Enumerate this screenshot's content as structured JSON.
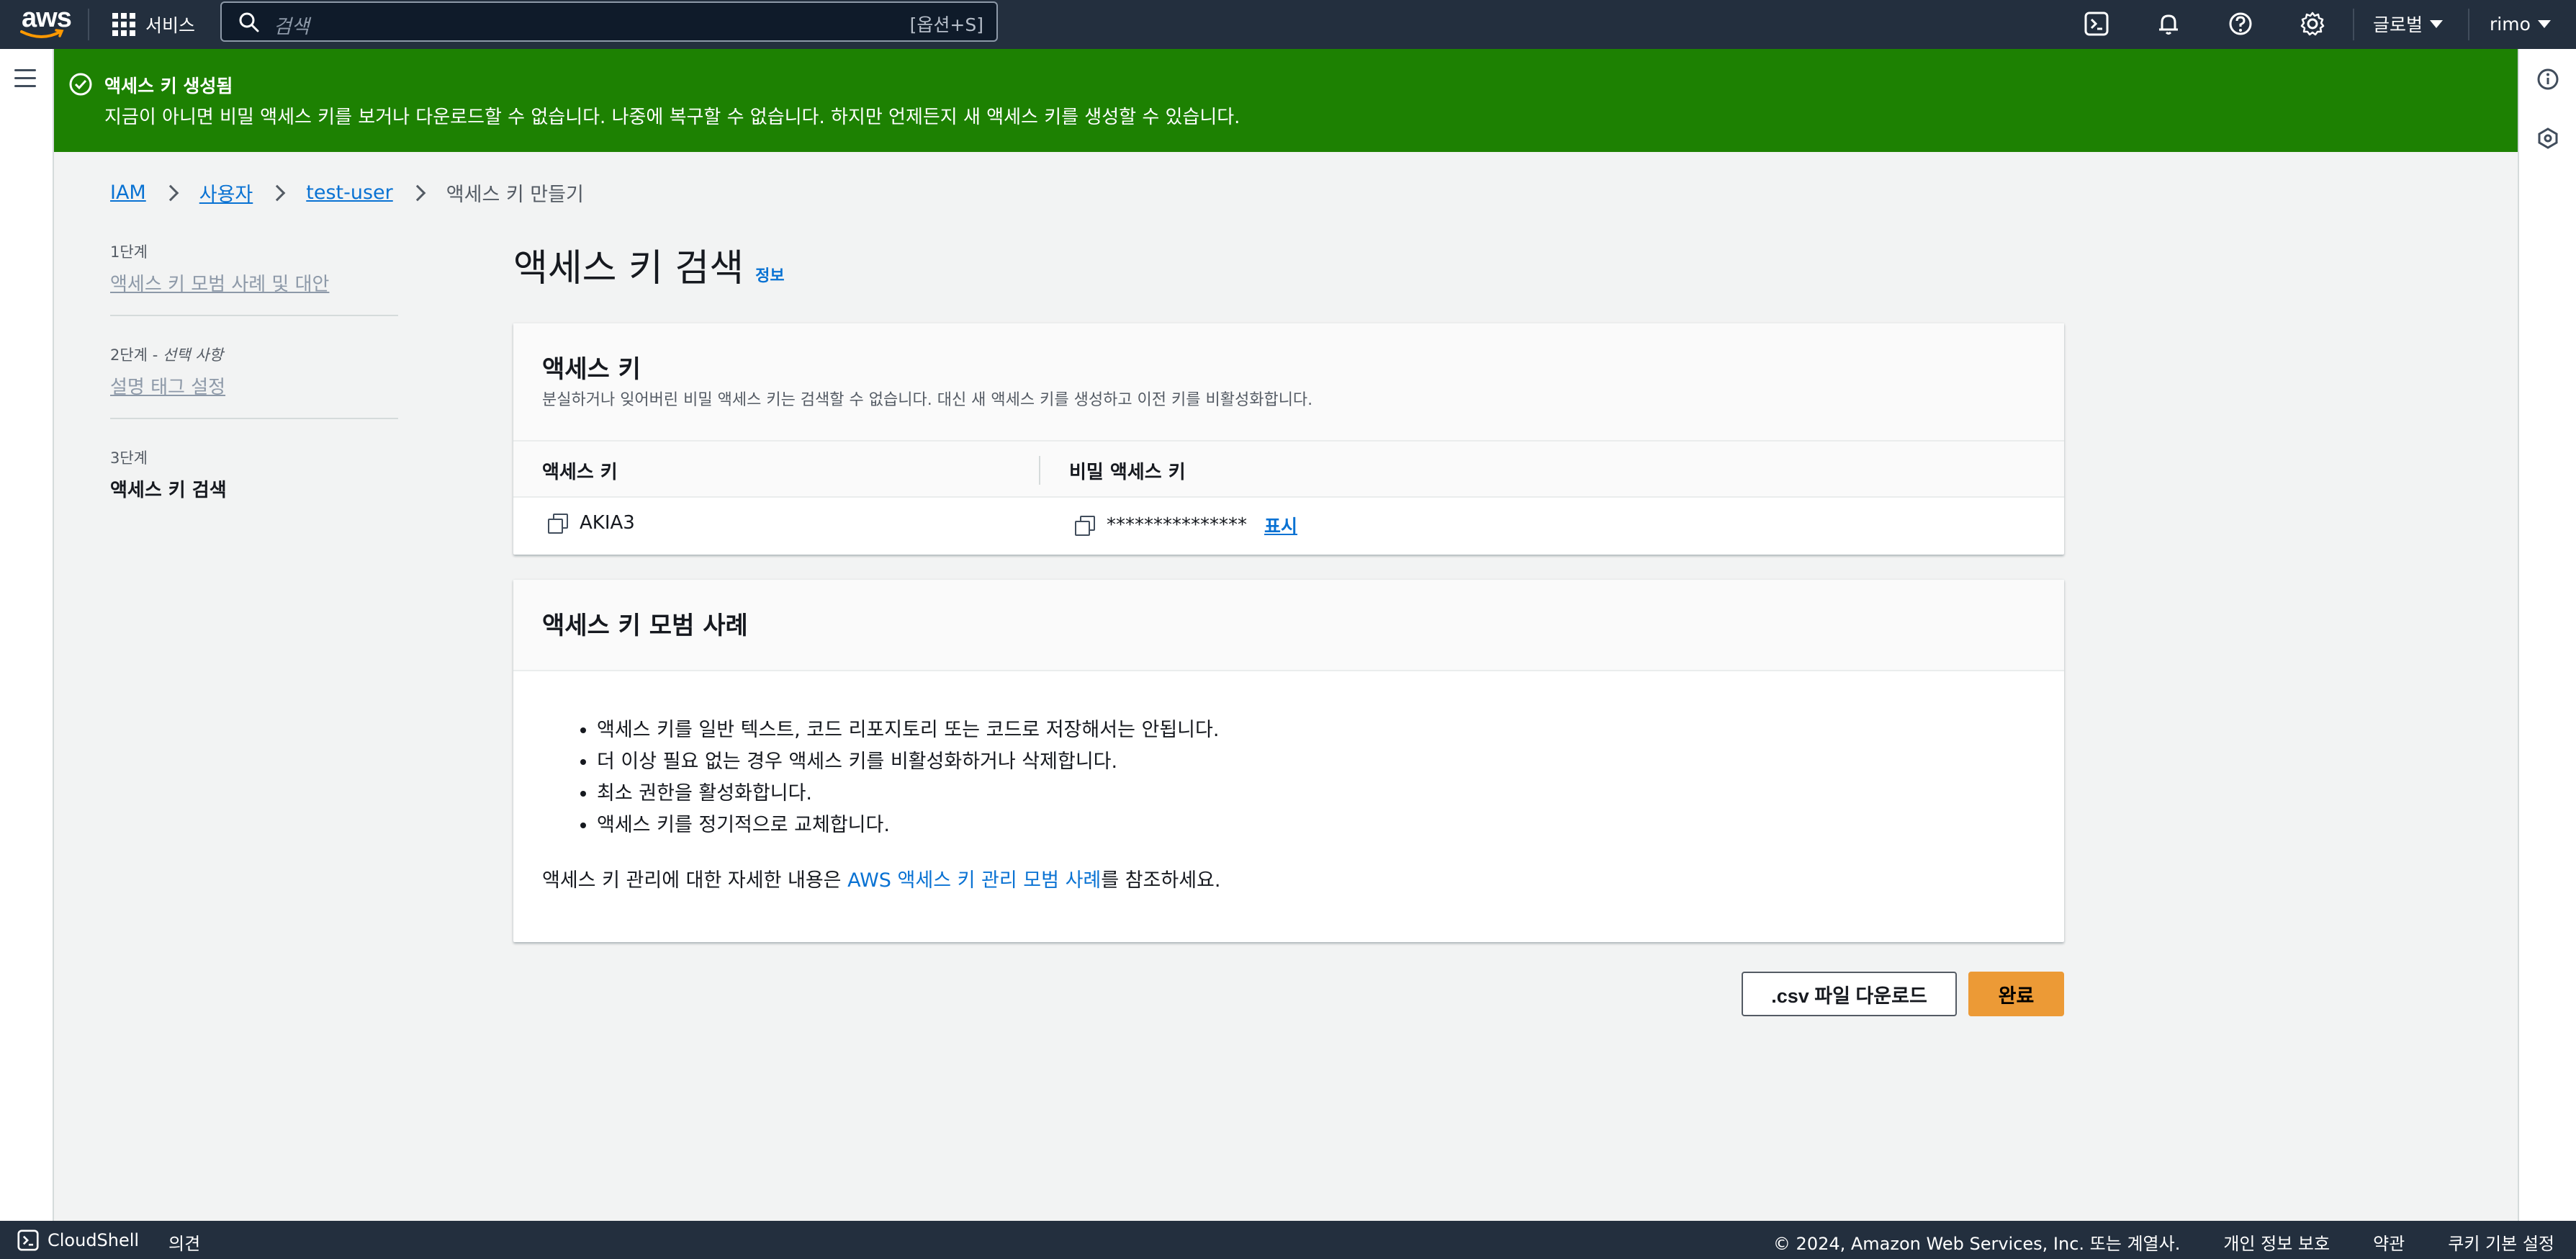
{
  "nav": {
    "logo_text": "aws",
    "services_label": "서비스",
    "search_placeholder": "검색",
    "search_shortcut": "[옵션+S]",
    "region_label": "글로벌",
    "user_label": "rimo"
  },
  "flash": {
    "title": "액세스 키 생성됨",
    "message": "지금이 아니면 비밀 액세스 키를 보거나 다운로드할 수 없습니다. 나중에 복구할 수 없습니다. 하지만 언제든지 새 액세스 키를 생성할 수 있습니다."
  },
  "breadcrumb": {
    "items": [
      "IAM",
      "사용자",
      "test-user"
    ],
    "current": "액세스 키 만들기"
  },
  "steps": [
    {
      "number": "1단계",
      "title": "액세스 키 모범 사례 및 대안"
    },
    {
      "number": "2단계",
      "optional": "선택 사항",
      "title": "설명 태그 설정"
    },
    {
      "number": "3단계",
      "title": "액세스 키 검색"
    }
  ],
  "page": {
    "title": "액세스 키 검색",
    "info_label": "정보"
  },
  "access_key_panel": {
    "title": "액세스 키",
    "description": "분실하거나 잊어버린 비밀 액세스 키는 검색할 수 없습니다. 대신 새 액세스 키를 생성하고 이전 키를 비활성화합니다.",
    "col_access_key": "액세스 키",
    "col_secret_key": "비밀 액세스 키",
    "access_key_value": "AKIA3",
    "secret_key_masked": "***************",
    "show_label": "표시"
  },
  "best_practices": {
    "title": "액세스 키 모범 사례",
    "items": [
      "액세스 키를 일반 텍스트, 코드 리포지토리 또는 코드로 저장해서는 안됩니다.",
      "더 이상 필요 없는 경우 액세스 키를 비활성화하거나 삭제합니다.",
      "최소 권한을 활성화합니다.",
      "액세스 키를 정기적으로 교체합니다."
    ],
    "footer_prefix": "액세스 키 관리에 대한 자세한 내용은 ",
    "footer_link": "AWS 액세스 키 관리 모범 사례",
    "footer_suffix": "를 참조하세요."
  },
  "actions": {
    "download_csv": ".csv 파일 다운로드",
    "done": "완료"
  },
  "footer": {
    "cloudshell": "CloudShell",
    "feedback": "의견",
    "copyright": "© 2024, Amazon Web Services, Inc. 또는 계열사.",
    "privacy": "개인 정보 보호",
    "terms": "약관",
    "cookies": "쿠키 기본 설정"
  },
  "colors": {
    "nav_bg": "#232f3e",
    "flash_success": "#1d8102",
    "link": "#0972d3",
    "primary_button": "#ec9a36"
  }
}
